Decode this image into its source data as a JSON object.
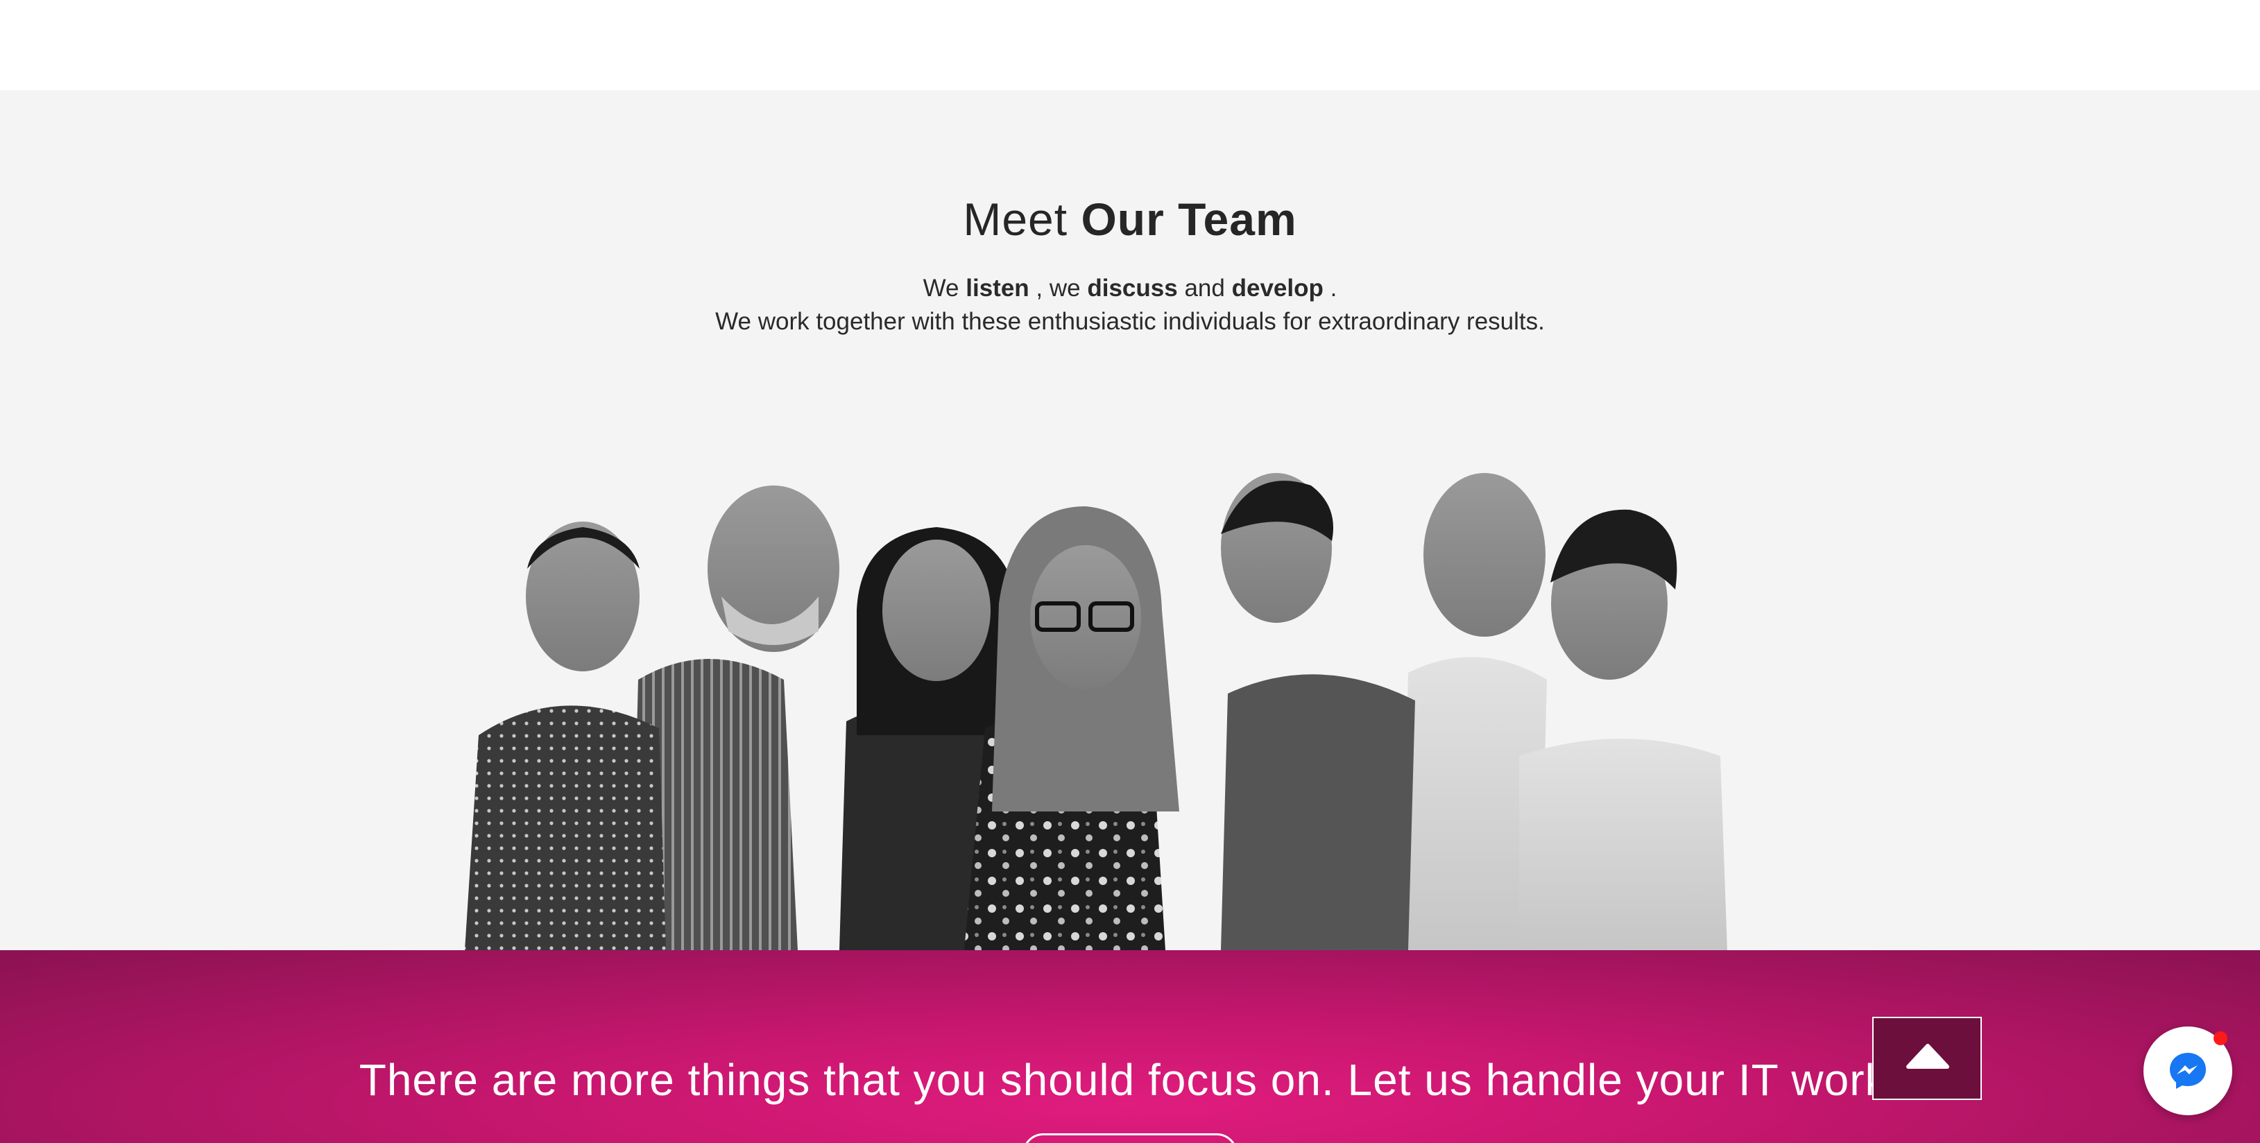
{
  "team": {
    "heading_light": "Meet",
    "heading_bold": "Our Team",
    "tagline_we": "We",
    "tagline_listen": "listen",
    "tagline_comma_we": ", we",
    "tagline_discuss": "discuss",
    "tagline_and": "and",
    "tagline_develop": "develop",
    "tagline_period": ".",
    "tagline_line2": "We work together with these enthusiastic individuals for extraordinary results.",
    "photo": "team-group-photo-grayscale"
  },
  "cta": {
    "text": "There are more things that you should focus on. Let us handle your IT work.",
    "button_label": ""
  },
  "widgets": {
    "scroll_top_icon": "chevron-up-icon",
    "messenger_icon": "messenger-icon",
    "messenger_color": "#1877f2",
    "notification_color": "#ff1a1a"
  },
  "colors": {
    "accent": "#d4187a",
    "accent_dark": "#6d0f3c",
    "section_bg": "#f4f4f4"
  }
}
